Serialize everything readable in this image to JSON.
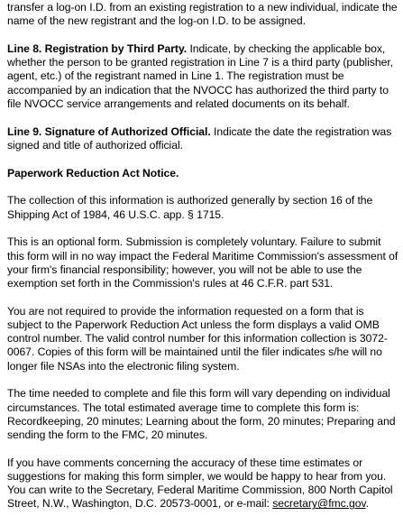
{
  "paragraphs": {
    "intro_continuation": "transfer a log-on I.D. from an existing registration to a new individual, indicate the name of the new registrant and the log-on I.D. to be assigned.",
    "line8_heading": "Line 8. Registration by Third Party.",
    "line8_text": " Indicate, by checking the applicable box, whether the person to be granted registration in Line 7 is a third party (publisher, agent, etc.) of the registrant named in Line 1. The registration must be accompanied by an indication that the NVOCC has authorized the third party to file NVOCC service arrangements and related documents on its behalf.",
    "line9_heading": "Line 9. Signature of Authorized Official.",
    "line9_text": " Indicate the date the registration was signed and title of authorized official.",
    "pra_heading": "Paperwork Reduction Act Notice.",
    "authority": "The collection of this information is authorized generally by section 16 of the Shipping Act of 1984, 46 U.S.C. app. § 1715.",
    "optional": "This is an optional form. Submission is completely voluntary. Failure to submit this form will in no way impact the Federal Maritime Commission's assessment of your firm's financial responsibility; however, you will not be able to use the exemption set forth in the Commission's rules at 46 C.F.R. part 531.",
    "omb": "You are not required to provide the information requested on a form that is subject to the Paperwork Reduction Act unless the form displays a valid OMB control number. The valid control number for this information collection is 3072-0067. Copies of this form will be maintained until the filer indicates s/he will no longer file NSAs into the electronic filing system.",
    "time": "The time needed to complete and file this form will vary depending on individual circumstances. The total estimated average time to complete this form is: Recordkeeping, 20 minutes; Learning about the form, 20 minutes; Preparing and sending the form to the FMC, 20 minutes.",
    "comments_text": "If you have comments concerning the accuracy of these time estimates or suggestions for making this form simpler, we would be happy to hear from you. You can write to the Secretary, Federal Maritime Commission, 800 North Capitol Street, N.W., Washington, D.C. 20573-0001, or e-mail: ",
    "comments_email": "secretary@fmc.gov",
    "comments_end": "."
  }
}
